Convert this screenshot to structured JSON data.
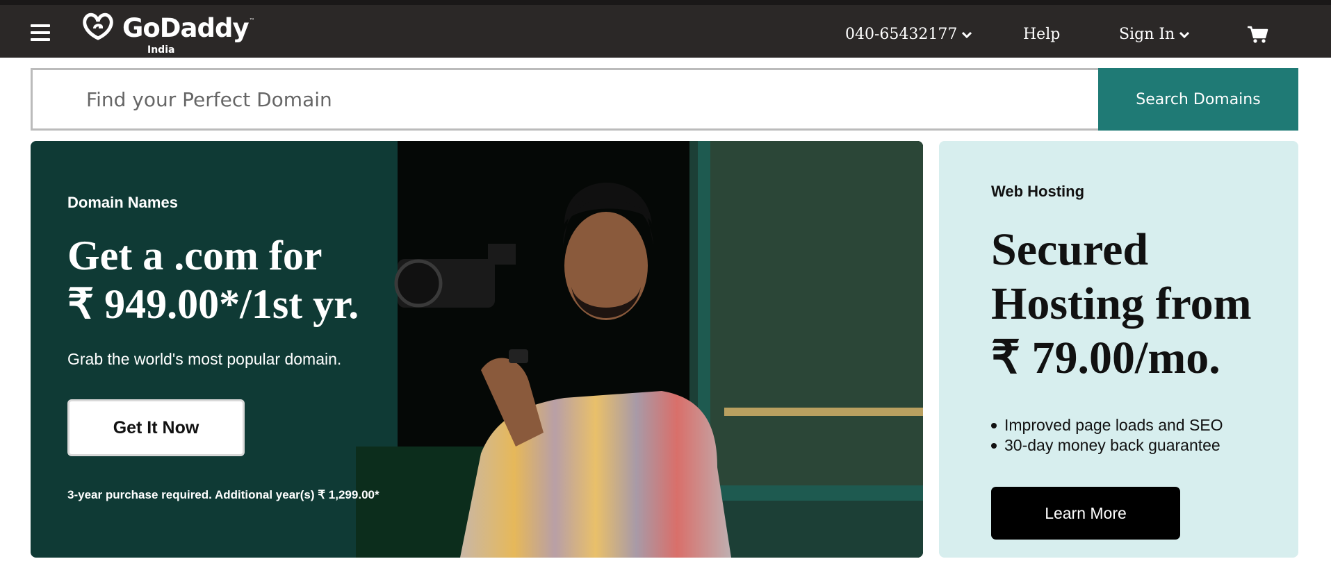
{
  "header": {
    "menu_icon": "hamburger-menu-icon",
    "logo_text": "GoDaddy",
    "logo_tm": "™",
    "logo_region": "India",
    "phone": "040-65432177",
    "help": "Help",
    "sign_in": "Sign In",
    "cart_icon": "shopping-cart-icon"
  },
  "search": {
    "placeholder": "Find your Perfect Domain",
    "button_label": "Search Domains"
  },
  "hero": {
    "eyebrow": "Domain Names",
    "title_line1": "Get a .com for",
    "title_line2": "₹ 949.00*/1st yr.",
    "subtitle": "Grab the world's most popular domain.",
    "cta_label": "Get It Now",
    "fineprint": "3-year purchase required. Additional year(s) ₹ 1,299.00*"
  },
  "hosting": {
    "eyebrow": "Web Hosting",
    "title_line1": "Secured",
    "title_line2": "Hosting from",
    "title_line3": "₹ 79.00/mo.",
    "bullets": [
      "Improved page loads and SEO",
      "30-day money back guarantee"
    ],
    "cta_label": "Learn More"
  },
  "colors": {
    "header_bg": "#2b2827",
    "search_button": "#1f7a75",
    "hero_bg": "#0f3a35",
    "hosting_bg": "#d7eeee",
    "learn_more_bg": "#000000"
  }
}
